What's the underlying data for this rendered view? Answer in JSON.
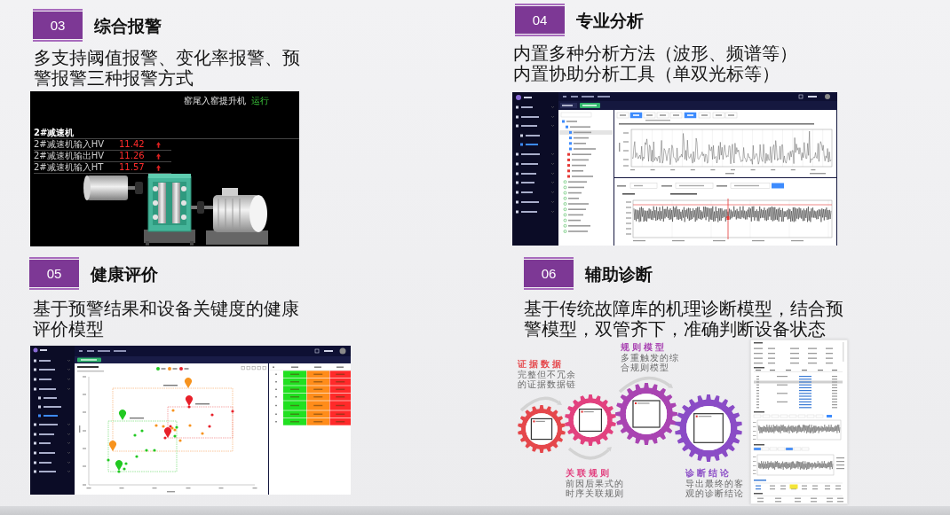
{
  "sections": [
    {
      "number": "03",
      "title": "综合报警",
      "description": [
        "多支持阈值报警、变化率报警、预警报警三种报警方式"
      ],
      "kind": "machine_monitor",
      "monitor": {
        "title": "窑尾入窑提升机",
        "status": "运行",
        "group": "2#减速机",
        "rows": [
          {
            "name": "2#减速机输入HV",
            "value": "11.42"
          },
          {
            "name": "2#减速机输出HV",
            "value": "11.26"
          },
          {
            "name": "2#减速机输入HT",
            "value": "11.57"
          }
        ]
      }
    },
    {
      "number": "04",
      "title": "专业分析",
      "description": [
        "内置多种分析方法（波形、频谱等）",
        "内置协助分析工具（单双光标等）"
      ],
      "kind": "waveform_analysis"
    },
    {
      "number": "05",
      "title": "健康评价",
      "description": [
        "基于预警结果和设备关键度的健康评价模型"
      ],
      "kind": "health_scatter"
    },
    {
      "number": "06",
      "title": "辅助诊断",
      "description": [
        "基于传统故障库的机理诊断模型，结合预警模型，双管齐下，准确判断设备状态"
      ],
      "kind": "diagnosis_flow",
      "steps": [
        {
          "title": "证据数据",
          "text": "完整但不冗余的证据数据链",
          "color": "#e5474b"
        },
        {
          "title": "关联规则",
          "text": "前因后果式的时序关联规则",
          "color": "#e2417f"
        },
        {
          "title": "规则模型",
          "text": "多重触发的综合规则模型",
          "color": "#a944b2"
        },
        {
          "title": "诊断结论",
          "text": "导出最终的客观的诊断结论",
          "color": "#8a4cc6"
        }
      ]
    }
  ]
}
